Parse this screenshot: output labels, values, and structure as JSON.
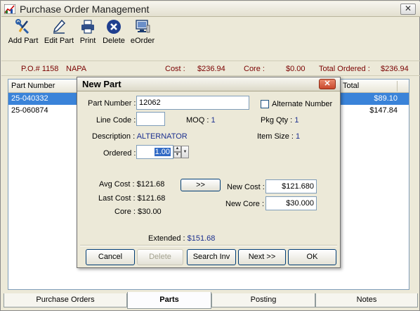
{
  "window": {
    "title": "Purchase Order Management"
  },
  "toolbar": {
    "add_part": "Add Part",
    "edit_part": "Edit Part",
    "print": "Print",
    "delete": "Delete",
    "eorder": "eOrder"
  },
  "po_bar": {
    "po_number": "P.O.# 1158",
    "vendor": "NAPA",
    "cost_label": "Cost :",
    "cost_value": "$236.94",
    "core_label": "Core :",
    "core_value": "$0.00",
    "total_label": "Total Ordered :",
    "total_value": "$236.94"
  },
  "grid": {
    "col_part_number": "Part Number",
    "col_total": "Total",
    "rows": [
      {
        "part_number": "25-040332",
        "total": "$89.10",
        "selected": true
      },
      {
        "part_number": "25-060874",
        "total": "$147.84",
        "selected": false
      }
    ]
  },
  "dialog": {
    "title": "New Part",
    "part_number_label": "Part Number :",
    "part_number_value": "12062",
    "alternate_number_label": "Alternate Number",
    "line_code_label": "Line Code :",
    "line_code_value": "",
    "moq_label": "MOQ :",
    "moq_value": "1",
    "pkg_qty_label": "Pkg Qty :",
    "pkg_qty_value": "1",
    "description_label": "Description :",
    "description_value": "ALTERNATOR",
    "item_size_label": "Item Size :",
    "item_size_value": "1",
    "ordered_label": "Ordered :",
    "ordered_value": "1.00",
    "avg_cost_label": "Avg Cost :",
    "avg_cost_value": "$121.68",
    "last_cost_label": "Last Cost :",
    "last_cost_value": "$121.68",
    "core_label": "Core :",
    "core_value": "$30.00",
    "transfer_button": ">>",
    "new_cost_label": "New Cost :",
    "new_cost_value": "$121.680",
    "new_core_label": "New Core :",
    "new_core_value": "$30.000",
    "extended_label": "Extended :",
    "extended_value": "$151.68",
    "buttons": {
      "cancel": "Cancel",
      "delete": "Delete",
      "search_inv": "Search Inv",
      "next": "Next >>",
      "ok": "OK"
    }
  },
  "tabs": {
    "purchase_orders": "Purchase Orders",
    "parts": "Parts",
    "posting": "Posting",
    "notes": "Notes"
  },
  "colors": {
    "po_bar_text": "#7a0000",
    "selection": "#3a83d9",
    "dialog_value_blue": "#1b2f8f"
  }
}
